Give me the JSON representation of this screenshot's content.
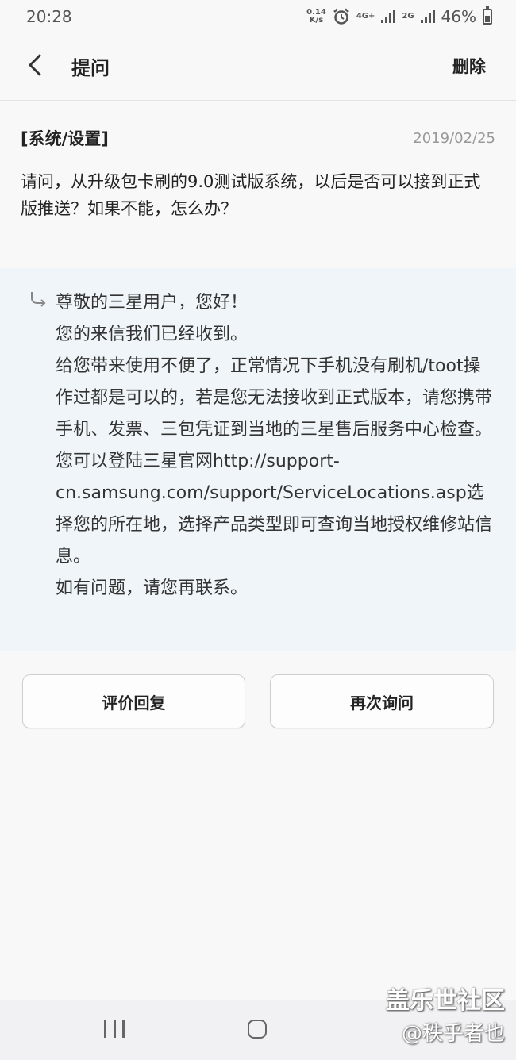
{
  "status_bar": {
    "time": "20:28",
    "net_speed_value": "0.14",
    "net_speed_unit": "K/s",
    "network_type": "4G+",
    "network_type_2": "2G",
    "battery": "46%"
  },
  "app_bar": {
    "title": "提问",
    "delete_label": "删除"
  },
  "question": {
    "category": "[系统/设置]",
    "date": "2019/02/25",
    "text": "请问，从升级包卡刷的9.0测试版系统，以后是否可以接到正式版推送？如果不能，怎么办？"
  },
  "answer": {
    "text": "尊敬的三星用户，您好！\n您的来信我们已经收到。\n给您带来使用不便了，正常情况下手机没有刷机/toot操作过都是可以的，若是您无法接收到正式版本，请您携带手机、发票、三包凭证到当地的三星售后服务中心检查。\n您可以登陆三星官网http://support-cn.samsung.com/support/ServiceLocations.asp选择您的所在地，选择产品类型即可查询当地授权维修站信息。\n如有问题，请您再联系。"
  },
  "actions": {
    "rate_label": "评价回复",
    "ask_again_label": "再次询问"
  },
  "watermark": {
    "line1": "盖乐世社区",
    "line2": "@秩乎者也"
  },
  "colors": {
    "answer_background": "#eff5f8",
    "page_background": "#f8f8f9",
    "date_text": "#999999"
  }
}
